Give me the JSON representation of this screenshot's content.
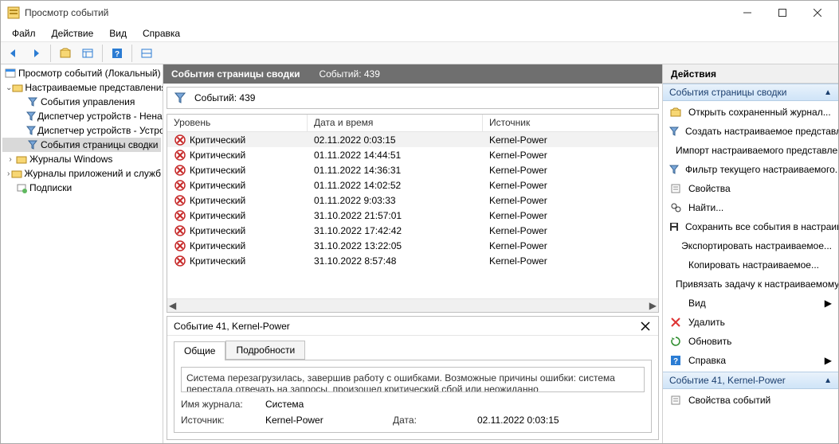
{
  "window": {
    "title": "Просмотр событий"
  },
  "menu": {
    "file": "Файл",
    "action": "Действие",
    "view": "Вид",
    "help": "Справка"
  },
  "tree": {
    "root": "Просмотр событий (Локальный)",
    "custom": "Настраиваемые представления",
    "admin": "События управления",
    "devmgr1": "Диспетчер устройств - Ненастроенные",
    "devmgr2": "Диспетчер устройств - Устройства",
    "summary": "События страницы сводки",
    "winlogs": "Журналы Windows",
    "applogs": "Журналы приложений и служб",
    "subs": "Подписки"
  },
  "header": {
    "title": "События страницы сводки",
    "count_label": "Событий: 439"
  },
  "filter": {
    "count_label": "Событий: 439"
  },
  "grid": {
    "cols": {
      "level": "Уровень",
      "date": "Дата и время",
      "source": "Источник"
    },
    "rows": [
      {
        "level": "Критический",
        "date": "02.11.2022 0:03:15",
        "source": "Kernel-Power"
      },
      {
        "level": "Критический",
        "date": "01.11.2022 14:44:51",
        "source": "Kernel-Power"
      },
      {
        "level": "Критический",
        "date": "01.11.2022 14:36:31",
        "source": "Kernel-Power"
      },
      {
        "level": "Критический",
        "date": "01.11.2022 14:02:52",
        "source": "Kernel-Power"
      },
      {
        "level": "Критический",
        "date": "01.11.2022 9:03:33",
        "source": "Kernel-Power"
      },
      {
        "level": "Критический",
        "date": "31.10.2022 21:57:01",
        "source": "Kernel-Power"
      },
      {
        "level": "Критический",
        "date": "31.10.2022 17:42:42",
        "source": "Kernel-Power"
      },
      {
        "level": "Критический",
        "date": "31.10.2022 13:22:05",
        "source": "Kernel-Power"
      },
      {
        "level": "Критический",
        "date": "31.10.2022 8:57:48",
        "source": "Kernel-Power"
      }
    ]
  },
  "detail": {
    "title": "Событие 41, Kernel-Power",
    "tabs": {
      "general": "Общие",
      "details": "Подробности"
    },
    "description": "Система перезагрузилась, завершив работу с ошибками. Возможные причины ошибки: система перестала отвечать на запросы, произошел критический сбой или неожиданно",
    "log_label": "Имя журнала:",
    "log_value": "Система",
    "source_label": "Источник:",
    "source_value": "Kernel-Power",
    "date_label": "Дата:",
    "date_value": "02.11.2022 0:03:15"
  },
  "actions": {
    "panel_title": "Действия",
    "group1": "События страницы сводки",
    "items1": {
      "open_saved": "Открыть сохраненный журнал...",
      "create_view": "Создать настраиваемое представление...",
      "import_view": "Импорт настраиваемого представления...",
      "filter_view": "Фильтр текущего настраиваемого...",
      "properties": "Свойства",
      "find": "Найти...",
      "save_all": "Сохранить все события в настраиваемом...",
      "export_view": "Экспортировать настраиваемое...",
      "copy_view": "Копировать настраиваемое...",
      "attach_task": "Привязать задачу к настраиваемому...",
      "view": "Вид",
      "delete": "Удалить",
      "refresh": "Обновить",
      "help": "Справка"
    },
    "group2": "Событие 41, Kernel-Power",
    "items2": {
      "event_props": "Свойства событий"
    }
  }
}
